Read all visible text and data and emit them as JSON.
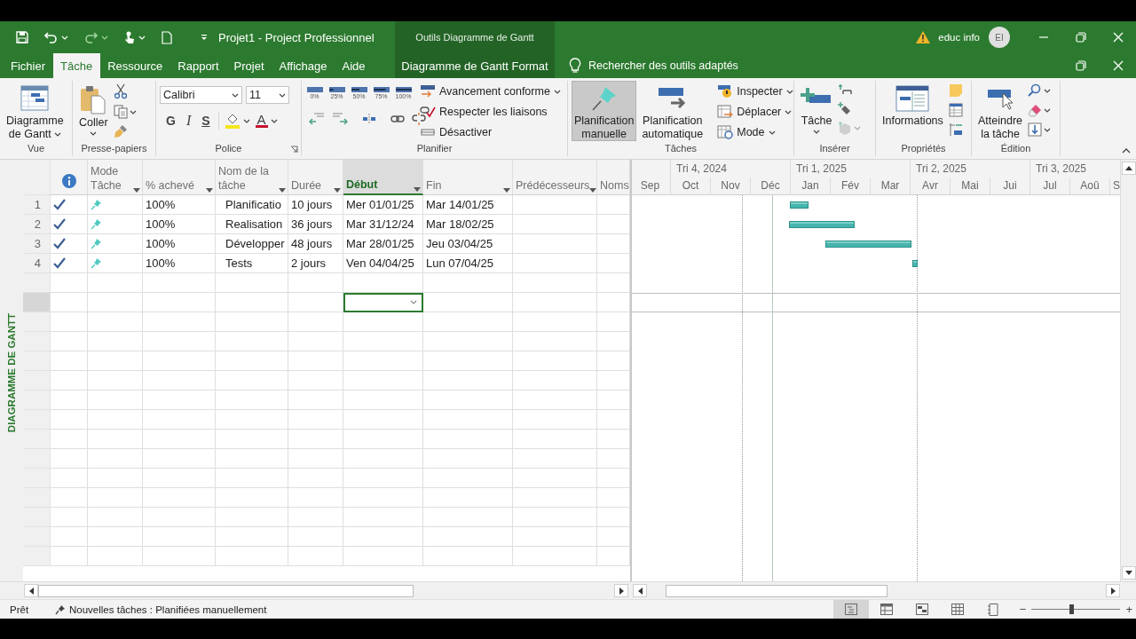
{
  "window": {
    "title": "Projet1 - Project Professionnel",
    "context_label": "Outils Diagramme de Gantt",
    "user": "educ info",
    "avatar": "EI"
  },
  "tabs": [
    {
      "label": "Fichier",
      "selected": false,
      "kind": "file"
    },
    {
      "label": "Tâche",
      "selected": true,
      "kind": "normal"
    },
    {
      "label": "Ressource",
      "selected": false,
      "kind": "normal"
    },
    {
      "label": "Rapport",
      "selected": false,
      "kind": "normal"
    },
    {
      "label": "Projet",
      "selected": false,
      "kind": "normal"
    },
    {
      "label": "Affichage",
      "selected": false,
      "kind": "normal"
    },
    {
      "label": "Aide",
      "selected": false,
      "kind": "normal"
    },
    {
      "label": "Diagramme de Gantt Format",
      "selected": false,
      "kind": "contextual"
    }
  ],
  "tell_me": "Rechercher des outils adaptés",
  "ribbon": [
    {
      "kind": "view",
      "label": "Vue",
      "button": {
        "label": "Diagramme\nde Gantt",
        "dropdown": true
      }
    },
    {
      "kind": "clipboard",
      "label": "Presse-papiers",
      "button": {
        "label": "Coller",
        "dropdown": true
      }
    },
    {
      "kind": "font",
      "label": "Police",
      "font": "Calibri",
      "size": "11",
      "bold": "G",
      "italic": "I",
      "underline": "S",
      "font_color": "A"
    },
    {
      "kind": "schedule",
      "label": "Planifier",
      "progress": [
        "0%",
        "25%",
        "50%",
        "75%",
        "100%"
      ],
      "commands": [
        {
          "label": "Avancement conforme",
          "dropdown": true
        },
        {
          "label": "Respecter les liaisons",
          "dropdown": false
        },
        {
          "label": "Désactiver",
          "dropdown": false
        }
      ]
    },
    {
      "kind": "tasks",
      "label": "Tâches",
      "modes": [
        {
          "label": "Planification\nmanuelle",
          "selected": true
        },
        {
          "label": "Planification\nautomatique",
          "selected": false
        }
      ],
      "commands": [
        {
          "label": "Inspecter",
          "dropdown": true
        },
        {
          "label": "Déplacer",
          "dropdown": true
        },
        {
          "label": "Mode",
          "dropdown": true
        }
      ]
    },
    {
      "kind": "insert",
      "label": "Insérer",
      "button": {
        "label": "Tâche",
        "dropdown": true
      }
    },
    {
      "kind": "properties",
      "label": "Propriétés",
      "button": {
        "label": "Informations",
        "dropdown": false
      }
    },
    {
      "kind": "editing",
      "label": "Édition",
      "button": {
        "label": "Atteindre\nla tâche",
        "dropdown": false
      }
    }
  ],
  "view_bar": "DIAGRAMME DE GANTT",
  "columns": [
    {
      "kind": "info",
      "selected": false,
      "filter": false
    },
    {
      "kind": "text",
      "label": "Mode\nTâche",
      "selected": false,
      "filter": true
    },
    {
      "kind": "text",
      "label": "% achevé",
      "selected": false,
      "filter": true
    },
    {
      "kind": "text",
      "label": "Nom de la\ntâche",
      "selected": false,
      "filter": true
    },
    {
      "kind": "text",
      "label": "Durée",
      "selected": false,
      "filter": true
    },
    {
      "kind": "text",
      "label": "Début",
      "selected": true,
      "filter": true
    },
    {
      "kind": "text",
      "label": "Fin",
      "selected": false,
      "filter": true
    },
    {
      "kind": "text",
      "label": "Prédécesseurs",
      "selected": false,
      "filter": true
    },
    {
      "kind": "text",
      "label": "Noms",
      "selected": false,
      "filter": false
    }
  ],
  "tasks": [
    {
      "number": "1",
      "complete": true,
      "manual": true,
      "percent": "100%",
      "name": "Planificatio",
      "duration": "10 jours",
      "start": "Mer 01/01/25",
      "finish": "Mar 14/01/25"
    },
    {
      "number": "2",
      "complete": true,
      "manual": true,
      "percent": "100%",
      "name": "Realisation",
      "duration": "36 jours",
      "start": "Mar 31/12/24",
      "finish": "Mar 18/02/25"
    },
    {
      "number": "3",
      "complete": true,
      "manual": true,
      "percent": "100%",
      "name": "Développer",
      "duration": "48 jours",
      "start": "Mar 28/01/25",
      "finish": "Jeu 03/04/25"
    },
    {
      "number": "4",
      "complete": true,
      "manual": true,
      "percent": "100%",
      "name": "Tests",
      "duration": "2 jours",
      "start": "Ven 04/04/25",
      "finish": "Lun 07/04/25"
    }
  ],
  "blank_rows": [
    {
      "selected": false
    },
    {
      "selected": true
    },
    {
      "selected": false
    },
    {
      "selected": false
    },
    {
      "selected": false
    },
    {
      "selected": false
    },
    {
      "selected": false
    },
    {
      "selected": false
    },
    {
      "selected": false
    },
    {
      "selected": false
    },
    {
      "selected": false
    },
    {
      "selected": false
    },
    {
      "selected": false
    },
    {
      "selected": false
    },
    {
      "selected": false
    }
  ],
  "timescale": {
    "quarters": [
      "Tri 4, 2024",
      "Tri 1, 2025",
      "Tri 2, 2025",
      "Tri 3, 2025"
    ],
    "months": [
      "Sep",
      "Oct",
      "Nov",
      "Déc",
      "Jan",
      "Fév",
      "Mar",
      "Avr",
      "Mai",
      "Jui",
      "Jul",
      "Aoû",
      "S"
    ]
  },
  "status_bar": {
    "ready": "Prêt",
    "new_tasks": "Nouvelles tâches : Planifiées manuellement",
    "views": [
      {
        "selected": true
      },
      {
        "selected": false
      },
      {
        "selected": false
      },
      {
        "selected": false
      },
      {
        "selected": false
      }
    ],
    "zoom": {
      "minus": "−",
      "plus": "+",
      "level": 0.45
    }
  }
}
